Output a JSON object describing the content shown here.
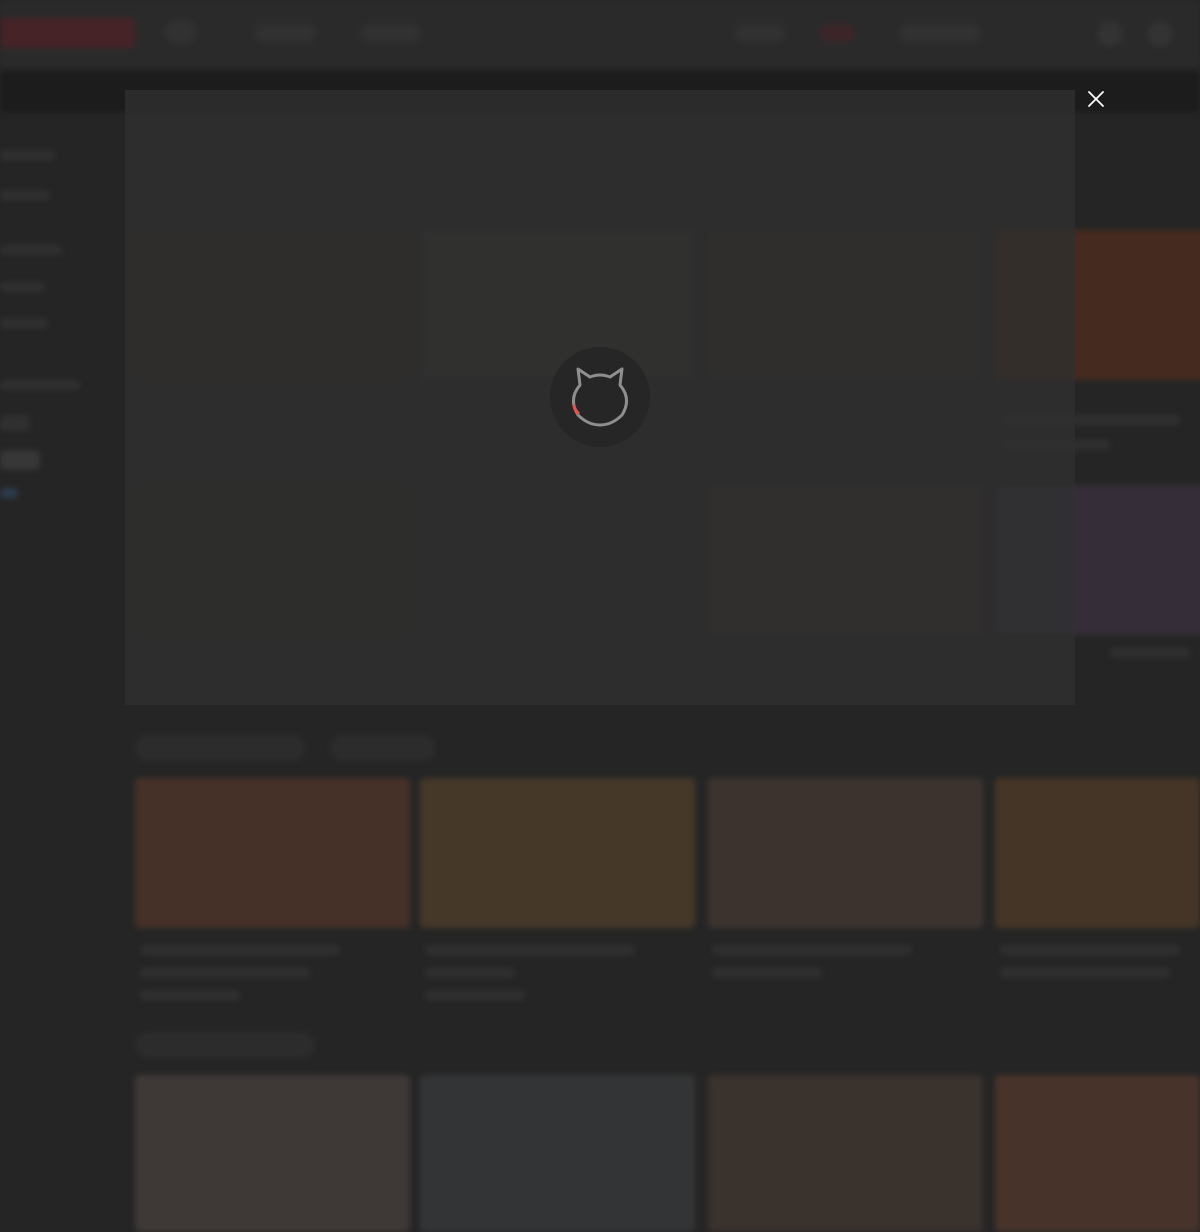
{
  "loading_modal": {
    "close_icon": "close-icon",
    "spinner_icon": "cat-face-spinner-icon",
    "spinner_accent_color": "#e0524f",
    "spinner_outline_color": "#8f8f8f"
  },
  "background_page": {
    "logo_color": "#6a2d34",
    "state": "blurred"
  }
}
